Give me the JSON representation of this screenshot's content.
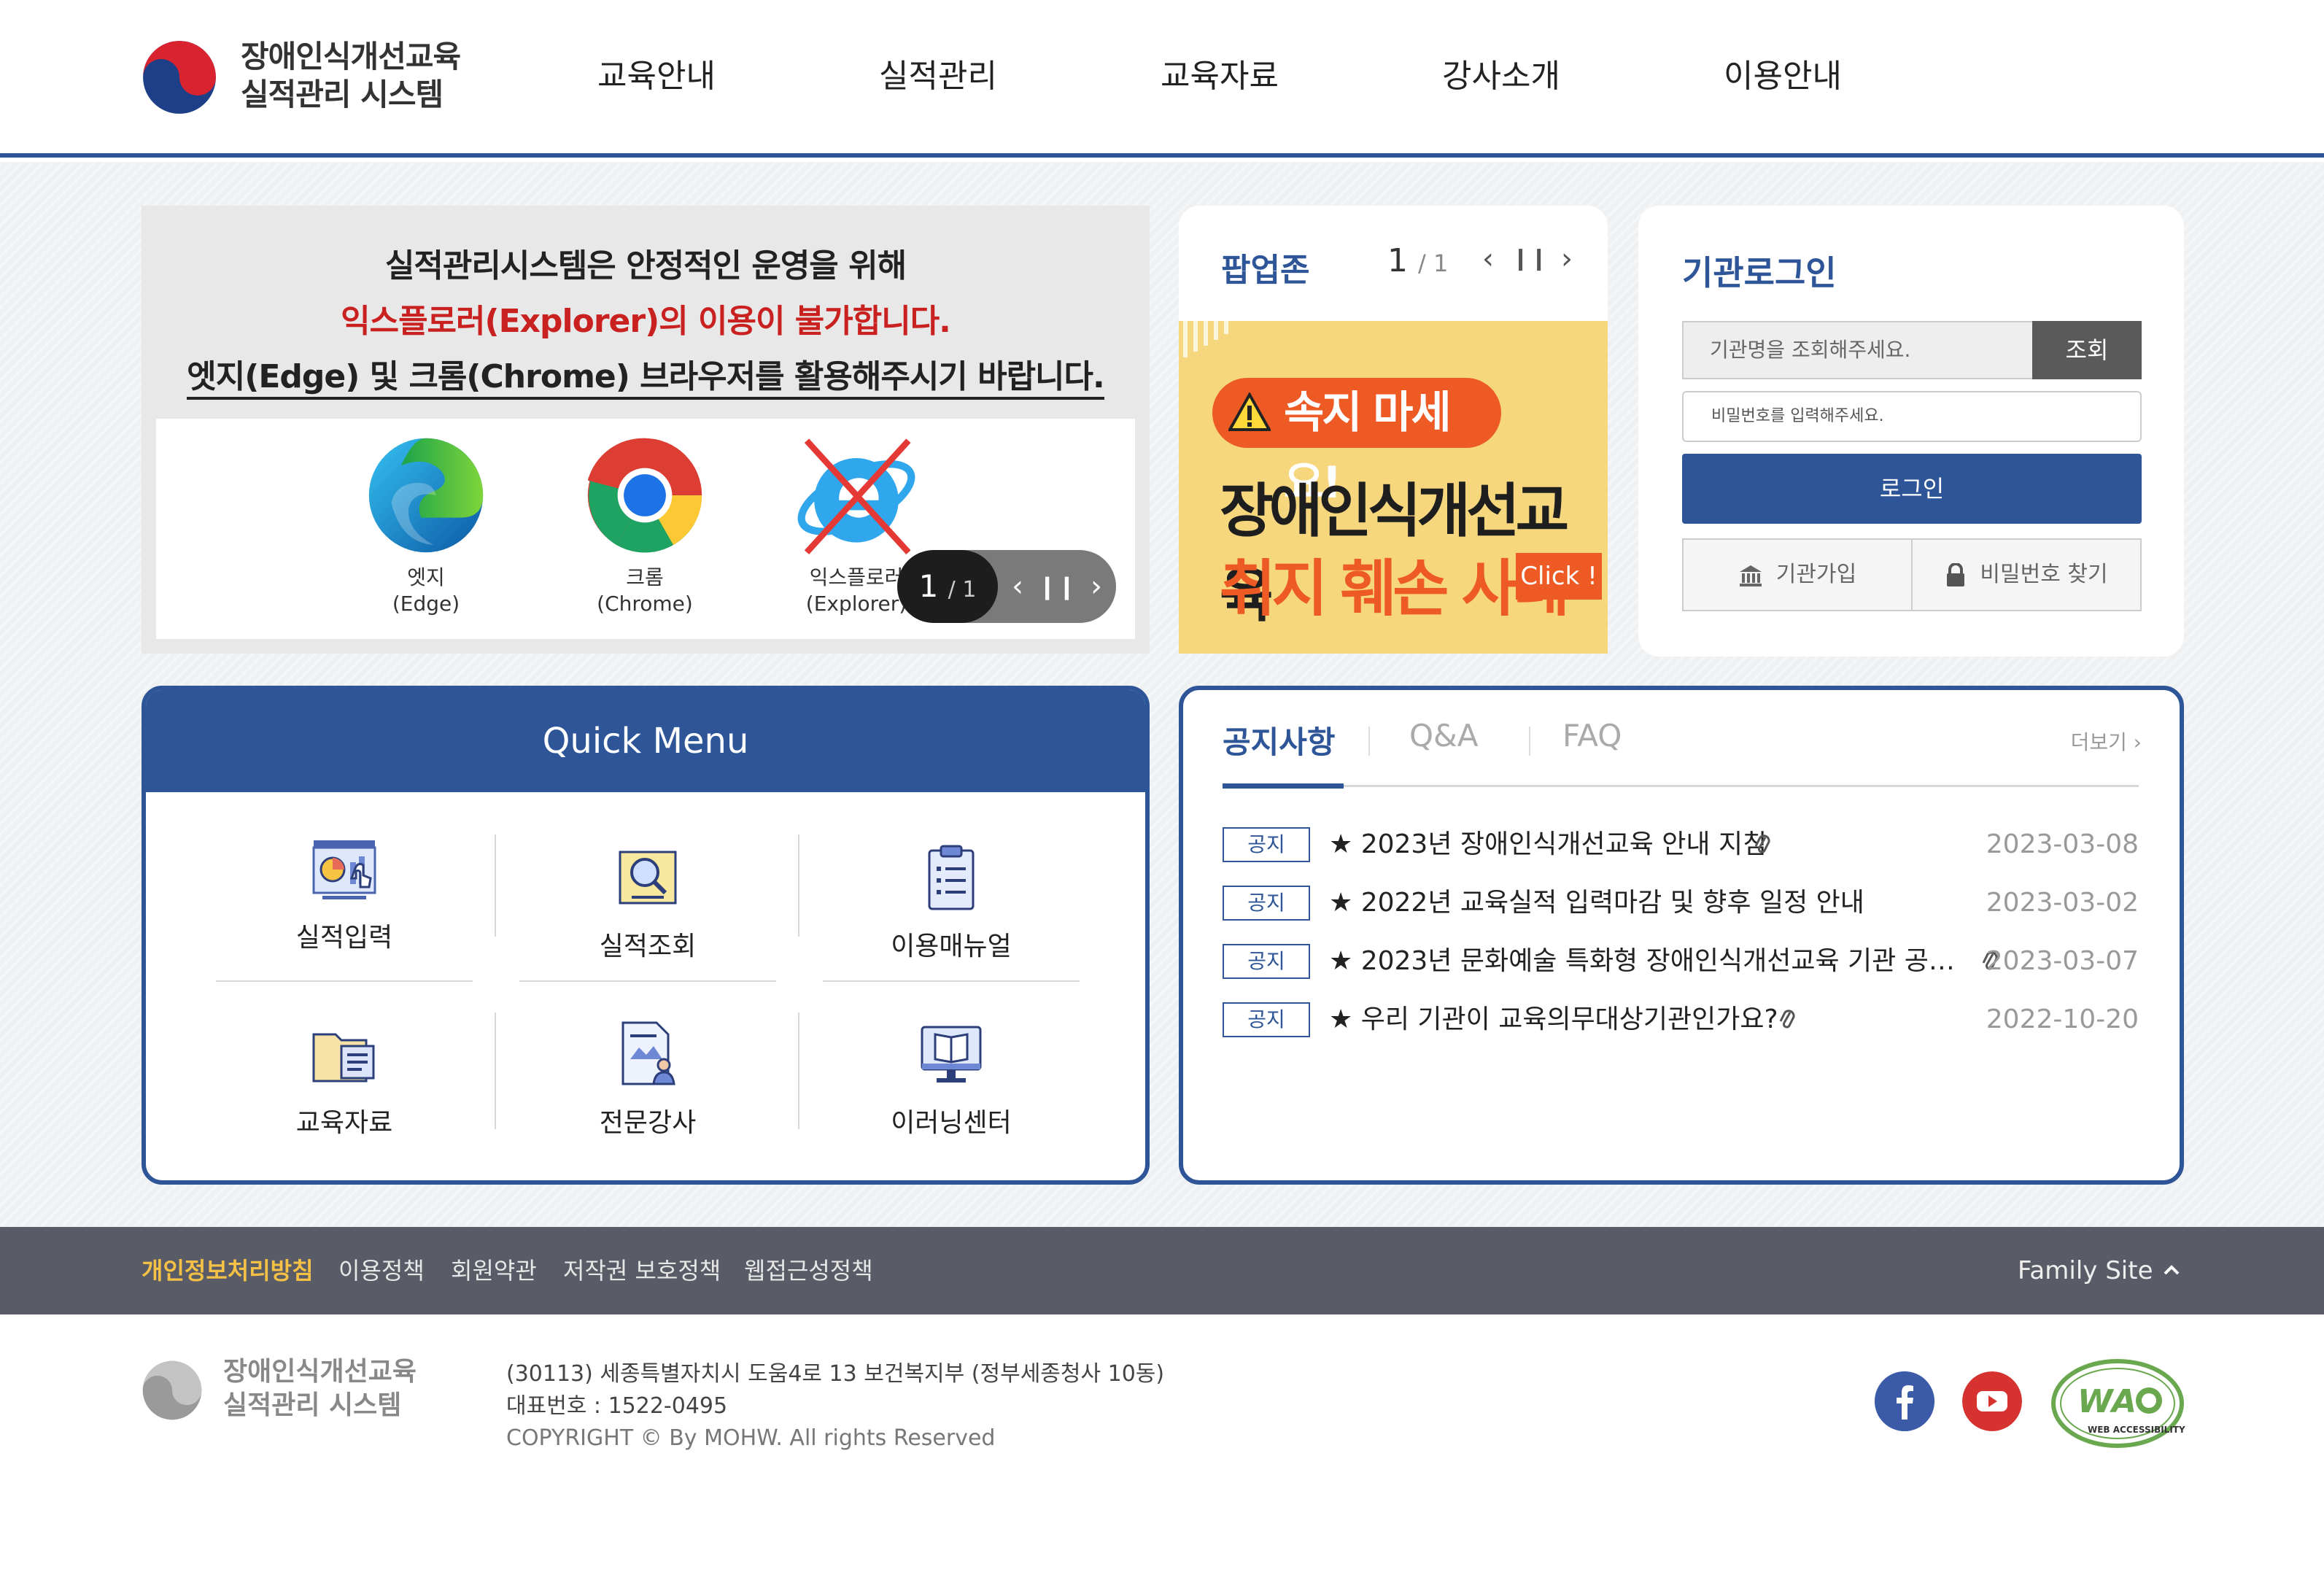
{
  "header": {
    "logo_line1": "장애인식개선교육",
    "logo_line2": "실적관리 시스템",
    "nav": [
      "교육안내",
      "실적관리",
      "교육자료",
      "강사소개",
      "이용안내"
    ]
  },
  "banner": {
    "line1": "실적관리시스템은 안정적인 운영을 위해",
    "line2": "익스플로러(Explorer)의 이용이 불가합니다.",
    "line3": "엣지(Edge) 및 크롬(Chrome) 브라우저를 활용해주시기 바랍니다.",
    "browsers": [
      {
        "name": "엣지",
        "en": "(Edge)"
      },
      {
        "name": "크롬",
        "en": "(Chrome)"
      },
      {
        "name": "익스플로러",
        "en": "(Explorer)"
      }
    ],
    "slide_current": "1",
    "slide_total": "/ 1"
  },
  "popup": {
    "title": "팝업존",
    "current": "1",
    "total": "/ 1",
    "warn_text": "속지 마세요!",
    "big_line1": "장애인식개선교육",
    "big_line2": "취지 훼손 사례",
    "click_label": "Click !"
  },
  "login": {
    "title": "기관로그인",
    "search_placeholder": "기관명을 조회해주세요.",
    "search_button": "조회",
    "password_placeholder": "비밀번호를 입력해주세요.",
    "login_button": "로그인",
    "join_label": "기관가입",
    "find_pw_label": "비밀번호 찾기"
  },
  "quick_menu": {
    "title": "Quick Menu",
    "items": [
      "실적입력",
      "실적조회",
      "이용매뉴얼",
      "교육자료",
      "전문강사",
      "이러닝센터"
    ]
  },
  "notice": {
    "tabs": [
      "공지사항",
      "Q&A",
      "FAQ"
    ],
    "more": "더보기",
    "rows": [
      {
        "badge": "공지",
        "title": "★ 2023년 장애인식개선교육 안내 지침",
        "date": "2023-03-08"
      },
      {
        "badge": "공지",
        "title": "★ 2022년 교육실적 입력마감 및 향후 일정 안내",
        "date": "2023-03-02"
      },
      {
        "badge": "공지",
        "title": "★ 2023년 문화예술 특화형 장애인식개선교육 기관 공…",
        "date": "2023-03-07"
      },
      {
        "badge": "공지",
        "title": "★ 우리 기관이 교육의무대상기관인가요?",
        "date": "2022-10-20"
      }
    ]
  },
  "footer": {
    "links": [
      "개인정보처리방침",
      "이용정책",
      "회원약관",
      "저작권 보호정책",
      "웹접근성정책"
    ],
    "family_site": "Family Site",
    "logo_line1": "장애인식개선교육",
    "logo_line2": "실적관리 시스템",
    "address": "(30113) 세종특별자치시 도움4로 13 보건복지부 (정부세종청사 10동)",
    "phone": "대표번호 : 1522-0495",
    "copyright": "COPYRIGHT © By MOHW. All rights Reserved",
    "wa_text": "WEB ACCESSIBILITY"
  },
  "colors": {
    "primary": "#2d5597",
    "accent_red": "#c8211f",
    "orange": "#ee5a24",
    "footer_bar": "#595c66",
    "highlight": "#f4c046"
  }
}
